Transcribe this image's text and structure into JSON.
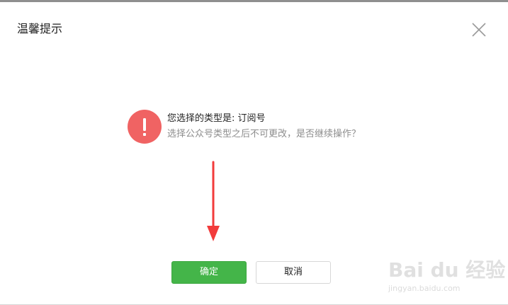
{
  "dialog": {
    "title": "温馨提示",
    "message_line1": "您选择的类型是: 订阅号",
    "message_line2": "选择公众号类型之后不可更改，是否继续操作？",
    "confirm_label": "确定",
    "cancel_label": "取消"
  },
  "icons": {
    "close": "close-icon",
    "warning": "exclamation-icon",
    "arrow": "down-arrow-annotation"
  },
  "watermark": {
    "brand": "Bai du 经验",
    "url": "jingyan.baidu.com"
  },
  "colors": {
    "warning": "#f06363",
    "confirm": "#44b549",
    "arrow": "#f23b3b"
  }
}
